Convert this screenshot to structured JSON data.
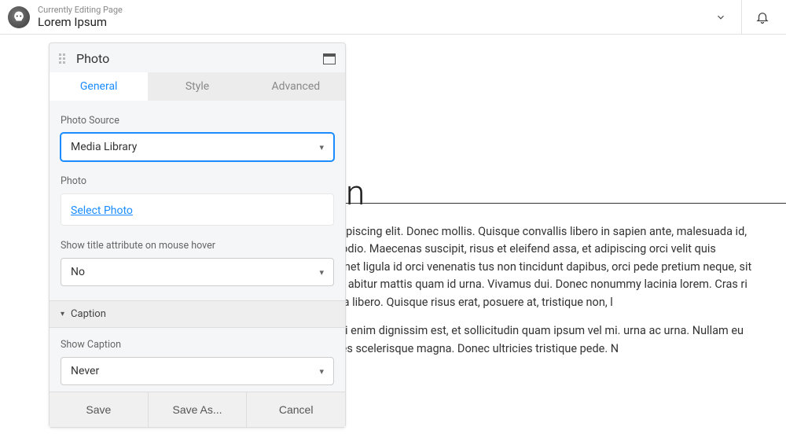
{
  "topbar": {
    "breadcrumb_label": "Currently Editing Page",
    "page_title": "Lorem Ipsum"
  },
  "panel": {
    "title": "Photo",
    "tabs": {
      "general": "General",
      "style": "Style",
      "advanced": "Advanced"
    },
    "fields": {
      "photo_source_label": "Photo Source",
      "photo_source_value": "Media Library",
      "photo_label": "Photo",
      "select_photo_link": "Select Photo",
      "show_title_label": "Show title attribute on mouse hover",
      "show_title_value": "No",
      "caption_section": "Caption",
      "show_caption_label": "Show Caption",
      "show_caption_value": "Never"
    },
    "buttons": {
      "save": "Save",
      "save_as": "Save As...",
      "cancel": "Cancel"
    }
  },
  "content": {
    "stub": "n",
    "p1": "amet, consectetuer adipiscing elit. Donec mollis. Quisque convallis libero in sapien ante, malesuada id, tempor eu, gravida id, odio. Maecenas suscipit, risus et eleifend assa, et adipiscing orci velit quis magna. Praesent sit amet ligula id orci venenatis tus non tincidunt dapibus, orci pede pretium neque, sit amet adipiscing ipsum abitur mattis quam id urna. Vivamus dui. Donec nonummy lacinia lorem. Cras ri mollis quis, justo. Sed a libero. Quisque risus erat, posuere at, tristique non, l",
    "p2": "is semper pharetra, nisi enim dignissim est, et sollicitudin quam ipsum vel mi. urna ac urna. Nullam eu tortor. Curabitur sodales scelerisque magna. Donec ultricies tristique pede. N"
  }
}
